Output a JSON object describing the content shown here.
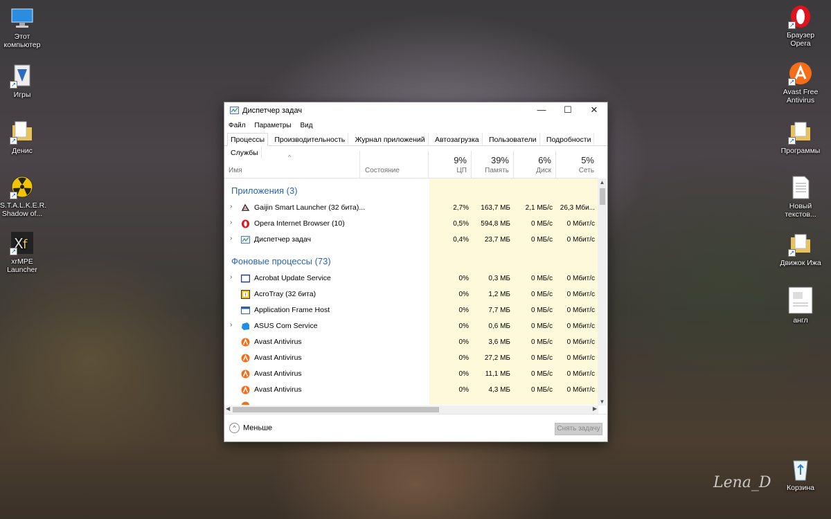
{
  "desktop": {
    "left_icons": [
      {
        "label": "Этот компьютер",
        "icon": "computer-icon"
      },
      {
        "label": "Игры",
        "icon": "games-shortcut-icon"
      },
      {
        "label": "Денис",
        "icon": "folder-icon"
      },
      {
        "label": "S.T.A.L.K.E.R. Shadow of...",
        "icon": "radiation-icon"
      },
      {
        "label": "xrMPE Launcher",
        "icon": "xr-launcher-icon"
      }
    ],
    "right_icons": [
      {
        "label": "Браузер Opera",
        "icon": "opera-icon"
      },
      {
        "label": "Avast Free Antivirus",
        "icon": "avast-icon"
      },
      {
        "label": "Программы",
        "icon": "folder-icon"
      },
      {
        "label": "Новый текстов...",
        "icon": "text-file-icon"
      },
      {
        "label": "Движок Ижа",
        "icon": "folder-icon"
      },
      {
        "label": "англ",
        "icon": "document-icon"
      },
      {
        "label": "Корзина",
        "icon": "recycle-bin-icon"
      }
    ],
    "watermark": "Lena_D"
  },
  "window": {
    "title": "Диспетчер задач",
    "menu": [
      "Файл",
      "Параметры",
      "Вид"
    ],
    "tabs": [
      "Процессы",
      "Производительность",
      "Журнал приложений",
      "Автозагрузка",
      "Пользователи",
      "Подробности",
      "Службы"
    ],
    "active_tab": "Процессы",
    "columns": {
      "name": "Имя",
      "status": "Состояние",
      "cpu": {
        "percent": "9%",
        "label": "ЦП"
      },
      "memory": {
        "percent": "39%",
        "label": "Память"
      },
      "disk": {
        "percent": "6%",
        "label": "Диск"
      },
      "network": {
        "percent": "5%",
        "label": "Сеть"
      }
    },
    "groups": [
      {
        "title": "Приложения (3)",
        "rows": [
          {
            "name": "Gaijin Smart Launcher (32 бита)...",
            "expandable": true,
            "icon": "gaijin-icon",
            "cpu": "2,7%",
            "mem": "163,7 МБ",
            "disk": "2,1 МБ/с",
            "net": "26,3 Мби..."
          },
          {
            "name": "Opera Internet Browser (10)",
            "expandable": true,
            "icon": "opera-icon",
            "cpu": "0,5%",
            "mem": "594,8 МБ",
            "disk": "0 МБ/с",
            "net": "0 Мбит/с"
          },
          {
            "name": "Диспетчер задач",
            "expandable": true,
            "icon": "task-manager-icon",
            "cpu": "0,4%",
            "mem": "23,7 МБ",
            "disk": "0 МБ/с",
            "net": "0 Мбит/с"
          }
        ]
      },
      {
        "title": "Фоновые процессы (73)",
        "rows": [
          {
            "name": "Acrobat Update Service",
            "expandable": true,
            "icon": "app-window-icon",
            "cpu": "0%",
            "mem": "0,3 МБ",
            "disk": "0 МБ/с",
            "net": "0 Мбит/с"
          },
          {
            "name": "AcroTray (32 бита)",
            "expandable": false,
            "icon": "acrotray-icon",
            "cpu": "0%",
            "mem": "1,2 МБ",
            "disk": "0 МБ/с",
            "net": "0 Мбит/с"
          },
          {
            "name": "Application Frame Host",
            "expandable": false,
            "icon": "app-frame-icon",
            "cpu": "0%",
            "mem": "7,7 МБ",
            "disk": "0 МБ/с",
            "net": "0 Мбит/с"
          },
          {
            "name": "ASUS Com Service",
            "expandable": true,
            "icon": "asus-icon",
            "cpu": "0%",
            "mem": "0,6 МБ",
            "disk": "0 МБ/с",
            "net": "0 Мбит/с"
          },
          {
            "name": "Avast Antivirus",
            "expandable": false,
            "icon": "avast-icon",
            "cpu": "0%",
            "mem": "3,6 МБ",
            "disk": "0 МБ/с",
            "net": "0 Мбит/с"
          },
          {
            "name": "Avast Antivirus",
            "expandable": false,
            "icon": "avast-icon",
            "cpu": "0%",
            "mem": "27,2 МБ",
            "disk": "0 МБ/с",
            "net": "0 Мбит/с"
          },
          {
            "name": "Avast Antivirus",
            "expandable": false,
            "icon": "avast-icon",
            "cpu": "0%",
            "mem": "11,1 МБ",
            "disk": "0 МБ/с",
            "net": "0 Мбит/с"
          },
          {
            "name": "Avast Antivirus",
            "expandable": false,
            "icon": "avast-icon",
            "cpu": "0%",
            "mem": "4,3 МБ",
            "disk": "0 МБ/с",
            "net": "0 Мбит/с"
          }
        ]
      }
    ],
    "footer": {
      "less_label": "Меньше",
      "end_task_label": "Снять задачу"
    },
    "colors": {
      "group_title": "#2a62b8",
      "cpu_highlight": "#fff4c4",
      "mem_highlight": "#fde8a0",
      "res_bg": "#fff9dc"
    }
  }
}
